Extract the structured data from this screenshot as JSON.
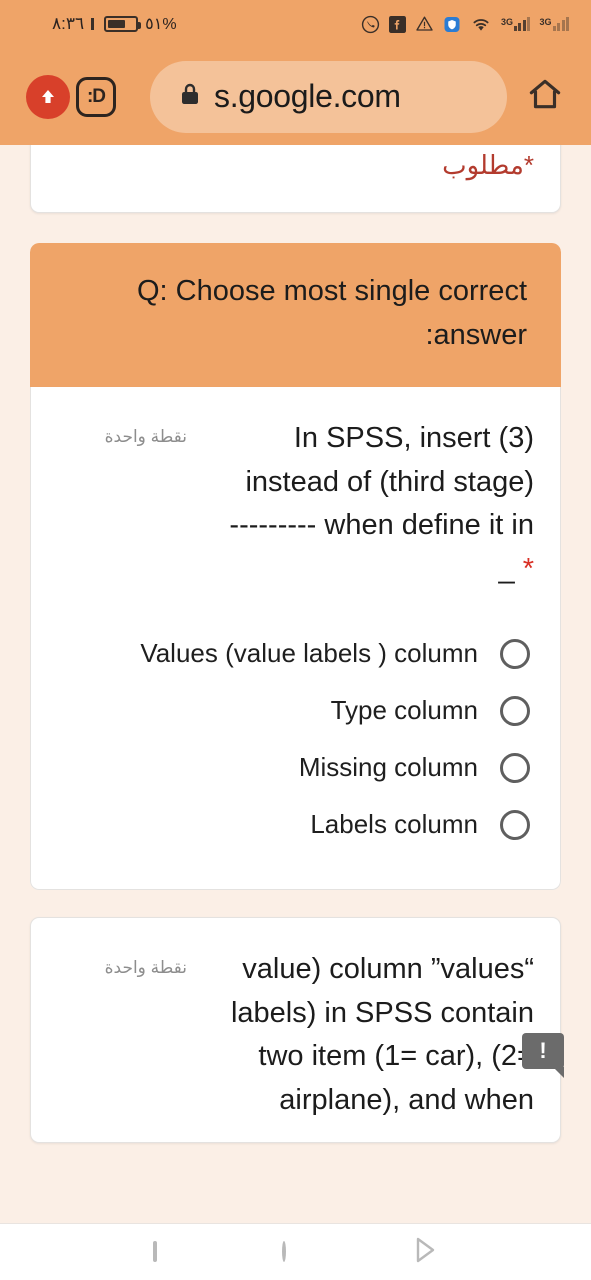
{
  "status_bar": {
    "time": "٨:٣٦",
    "battery_percent": "٥١%",
    "icons": [
      "viber-icon",
      "facebook-icon",
      "warning-triangle-icon",
      "shield-icon",
      "wifi-icon",
      "signal-3g-icon",
      "signal-3g-icon-2"
    ]
  },
  "browser": {
    "url": "s.google.com",
    "lock_icon": "lock-icon",
    "upload_icon": "upload-arrow-icon",
    "profile_label": ":D",
    "home_icon": "home-icon"
  },
  "form": {
    "required_note": "*مطلوب",
    "section_header": "Q: Choose most single correct answer:",
    "questions": [
      {
        "points": "نقطة واحدة",
        "text": "In SPSS, insert (3) instead of (third stage) when define it in --------- ",
        "required_mark": "*",
        "trailing_dash": "_",
        "options": [
          "Values (value labels ) column",
          "Type column",
          "Missing column",
          "Labels column"
        ]
      },
      {
        "points": "نقطة واحدة",
        "text": "“value) column ”values labels) in SPSS contain two item (1= car), (2= airplane), and when"
      }
    ],
    "feedback_badge": "!"
  },
  "nav_bar": {
    "recents_icon": "square-recents-icon",
    "home_icon": "circle-home-icon",
    "back_icon": "triangle-back-icon"
  },
  "colors": {
    "accent_orange": "#EFA468",
    "page_background": "#FBEFE6",
    "required_red": "#B33B2E",
    "asterisk_red": "#D93025",
    "card_white": "#FFFFFF"
  }
}
